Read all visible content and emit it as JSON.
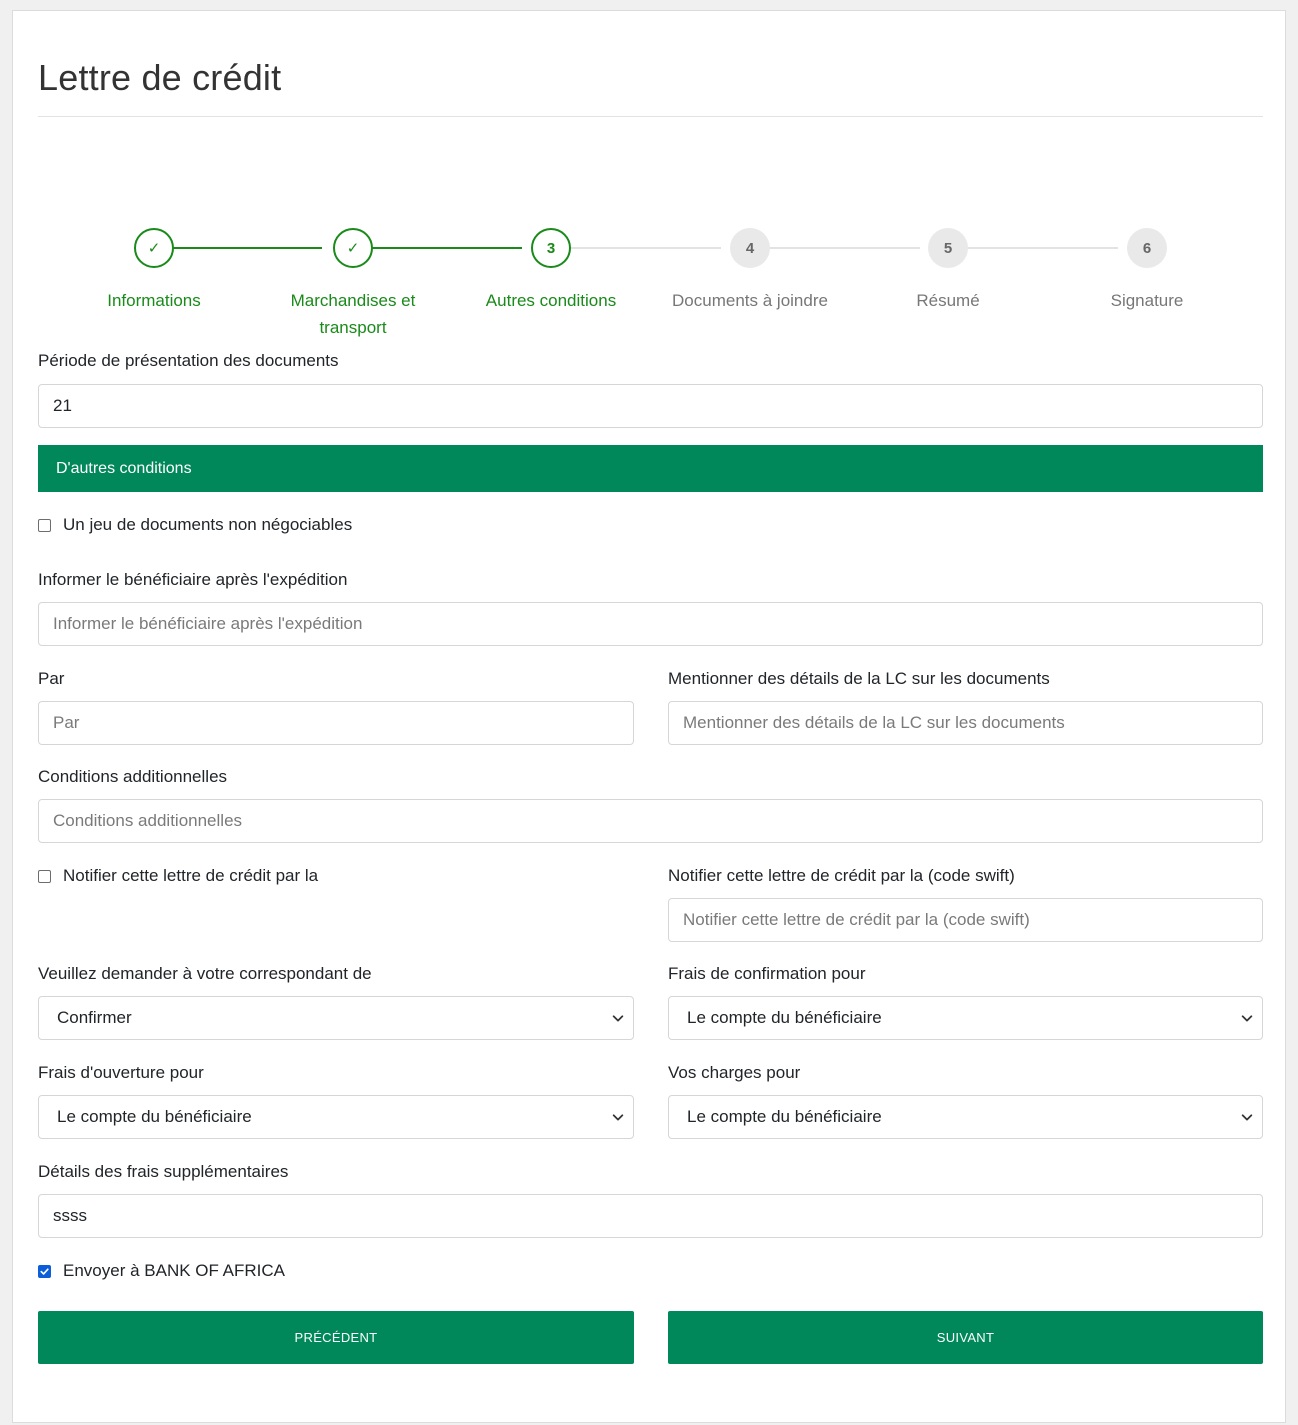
{
  "page": {
    "title": "Lettre de crédit"
  },
  "stepper": {
    "steps": [
      {
        "number": "✓",
        "label": "Informations",
        "state": "done"
      },
      {
        "number": "✓",
        "label": "Marchandises et transport",
        "state": "done"
      },
      {
        "number": "3",
        "label": "Autres conditions",
        "state": "active"
      },
      {
        "number": "4",
        "label": "Documents à joindre",
        "state": "todo"
      },
      {
        "number": "5",
        "label": "Résumé",
        "state": "todo"
      },
      {
        "number": "6",
        "label": "Signature",
        "state": "todo"
      }
    ],
    "colors": {
      "done": "#1a8a1a",
      "todo": "#e9e9e9"
    }
  },
  "form": {
    "presentation_period": {
      "label": "Période de présentation des documents",
      "value": "21"
    },
    "section_title": "D'autres conditions",
    "non_negotiable": {
      "label": "Un jeu de documents non négociables",
      "checked": false
    },
    "inform_beneficiary": {
      "label": "Informer le bénéficiaire après l'expédition",
      "placeholder": "Informer le bénéficiaire après l'expédition",
      "value": ""
    },
    "by": {
      "label": "Par",
      "placeholder": "Par",
      "value": ""
    },
    "lc_details": {
      "label": "Mentionner des détails de la LC sur les documents",
      "placeholder": "Mentionner des détails de la LC sur les documents",
      "value": ""
    },
    "additional_conditions": {
      "label": "Conditions additionnelles",
      "placeholder": "Conditions additionnelles",
      "value": ""
    },
    "notify_by": {
      "label": "Notifier cette lettre de crédit par la",
      "checked": false
    },
    "notify_swift": {
      "label": "Notifier cette lettre de crédit par la (code swift)",
      "placeholder": "Notifier cette lettre de crédit par la (code swift)",
      "value": ""
    },
    "correspondent": {
      "label": "Veuillez demander à votre correspondant de",
      "selected": "Confirmer"
    },
    "confirmation_fees": {
      "label": "Frais de confirmation pour",
      "selected": "Le compte du bénéficiaire"
    },
    "opening_fees": {
      "label": "Frais d'ouverture pour",
      "selected": "Le compte du bénéficiaire"
    },
    "your_charges": {
      "label": "Vos charges pour",
      "selected": "Le compte du bénéficiaire"
    },
    "extra_fees_details": {
      "label": "Détails des frais supplémentaires",
      "value": "ssss"
    },
    "send_to_bank": {
      "label": "Envoyer à BANK OF AFRICA",
      "checked": true
    }
  },
  "buttons": {
    "previous": "PRÉCÉDENT",
    "next": "SUIVANT"
  },
  "colors": {
    "accent": "#00875a",
    "check_blue": "#0b5ed7"
  }
}
